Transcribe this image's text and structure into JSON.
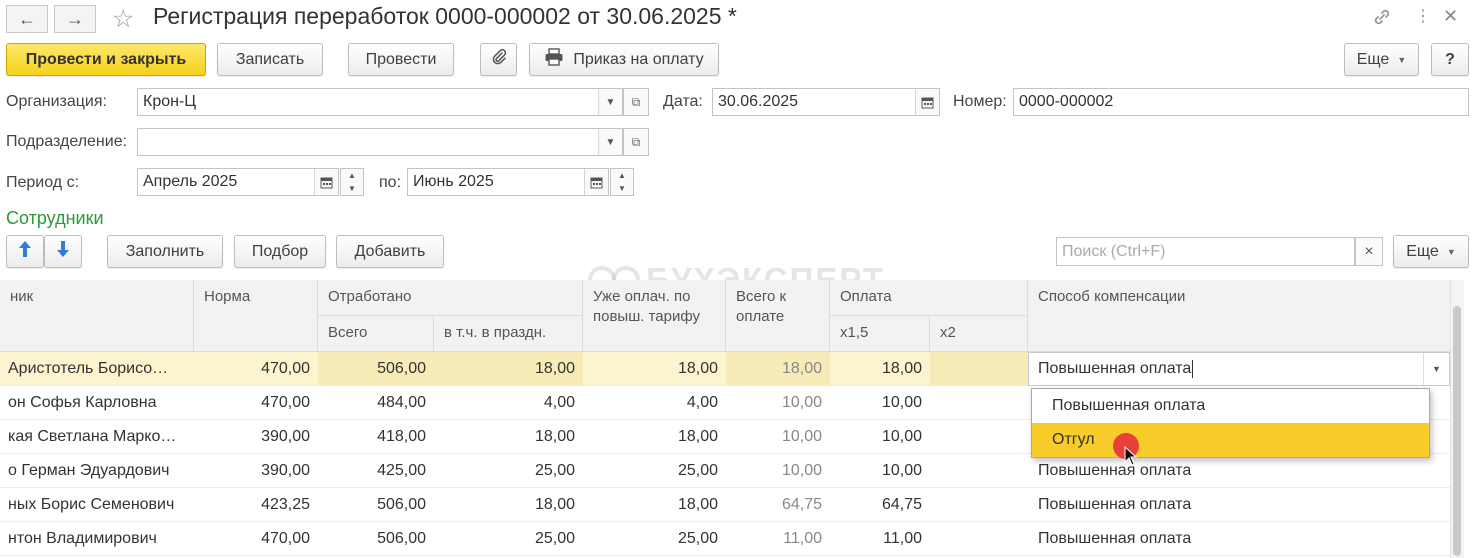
{
  "window": {
    "title": "Регистрация переработок 0000-000002 от 30.06.2025 *",
    "back_icon": "←",
    "forward_icon": "→"
  },
  "toolbar": {
    "post_close": "Провести и закрыть",
    "save": "Записать",
    "post": "Провести",
    "print_order": "Приказ на оплату",
    "more": "Еще",
    "help": "?"
  },
  "form": {
    "org_label": "Организация:",
    "org_value": "Крон-Ц",
    "date_label": "Дата:",
    "date_value": "30.06.2025",
    "number_label": "Номер:",
    "number_value": "0000-000002",
    "division_label": "Подразделение:",
    "division_value": "",
    "period_from_label": "Период с:",
    "period_from_value": "Апрель 2025",
    "period_to_label": "по:",
    "period_to_value": "Июнь 2025"
  },
  "employees": {
    "section_title": "Сотрудники",
    "fill": "Заполнить",
    "pick": "Подбор",
    "add": "Добавить",
    "search_placeholder": "Поиск (Ctrl+F)",
    "more": "Еще",
    "clear": "×"
  },
  "watermark": "БУХЭКСПЕРТ",
  "table": {
    "headers": {
      "employee": "ник",
      "norm": "Норма",
      "worked": "Отработано",
      "worked_total": "Всего",
      "worked_holiday": "в т.ч. в праздн.",
      "already_paid": "Уже оплач. по повыш. тарифу",
      "total_to_pay": "Всего к оплате",
      "payment": "Оплата",
      "x15": "x1,5",
      "x2": "x2",
      "method": "Способ компенсации"
    },
    "rows": [
      {
        "name": "Аристотель Борисо…",
        "norm": "470,00",
        "worked": "506,00",
        "holiday": "18,00",
        "paid": "18,00",
        "total": "18,00",
        "x15": "18,00",
        "x2": "",
        "method": "Повышенная оплата"
      },
      {
        "name": "он Софья Карловна",
        "norm": "470,00",
        "worked": "484,00",
        "holiday": "4,00",
        "paid": "4,00",
        "total": "10,00",
        "x15": "10,00",
        "x2": "",
        "method": ""
      },
      {
        "name": "кая Светлана Марко…",
        "norm": "390,00",
        "worked": "418,00",
        "holiday": "18,00",
        "paid": "18,00",
        "total": "10,00",
        "x15": "10,00",
        "x2": "",
        "method": ""
      },
      {
        "name": "о Герман Эдуардович",
        "norm": "390,00",
        "worked": "425,00",
        "holiday": "25,00",
        "paid": "25,00",
        "total": "10,00",
        "x15": "10,00",
        "x2": "",
        "method": "Повышенная оплата"
      },
      {
        "name": "ных Борис Семенович",
        "norm": "423,25",
        "worked": "506,00",
        "holiday": "18,00",
        "paid": "18,00",
        "total": "64,75",
        "x15": "64,75",
        "x2": "",
        "method": "Повышенная оплата"
      },
      {
        "name": "нтон Владимирович",
        "norm": "470,00",
        "worked": "506,00",
        "holiday": "25,00",
        "paid": "25,00",
        "total": "11,00",
        "x15": "11,00",
        "x2": "",
        "method": "Повышенная оплата"
      }
    ]
  },
  "editor_value": "Повышенная оплата",
  "dropdown": {
    "options": [
      "Повышенная оплата",
      "Отгул"
    ],
    "highlighted_index": 1
  },
  "colors": {
    "primary_button": "#f6d21a",
    "section_title": "#2c9a3a",
    "selected_row": "#fcf3cf",
    "dropdown_highlight": "#f8cc2a"
  }
}
